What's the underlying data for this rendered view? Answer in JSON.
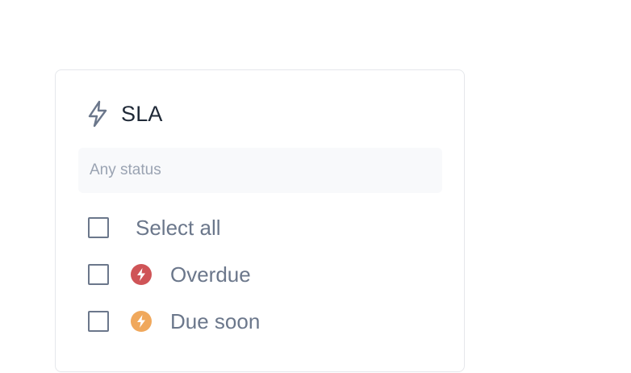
{
  "filter": {
    "title": "SLA",
    "search_placeholder": "Any status",
    "select_all_label": "Select all",
    "options": [
      {
        "label": "Overdue",
        "icon": "lightning-icon",
        "color": "#cf5457",
        "checked": false
      },
      {
        "label": "Due soon",
        "icon": "lightning-icon",
        "color": "#f0a85c",
        "checked": false
      }
    ],
    "select_all_checked": false
  },
  "colors": {
    "header_icon": "#6b778b",
    "text": "#6b778b",
    "title": "#1f2937",
    "overdue": "#cf5457",
    "due_soon": "#f0a85c"
  }
}
